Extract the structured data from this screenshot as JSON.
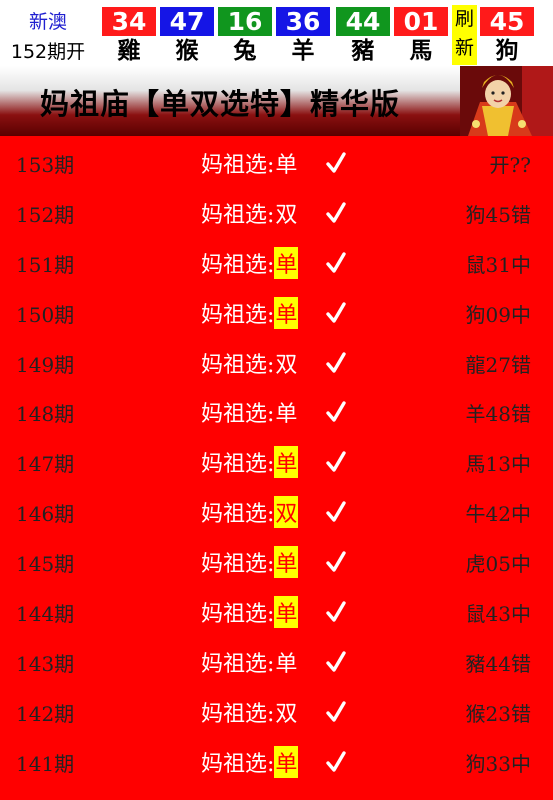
{
  "header": {
    "region": "新澳",
    "period": "152期开",
    "balls": [
      {
        "number": "34",
        "zodiac": "雞",
        "color": "#ff1a1a"
      },
      {
        "number": "47",
        "zodiac": "猴",
        "color": "#1515e6"
      },
      {
        "number": "16",
        "zodiac": "兔",
        "color": "#10961e"
      },
      {
        "number": "36",
        "zodiac": "羊",
        "color": "#1515e6"
      },
      {
        "number": "44",
        "zodiac": "豬",
        "color": "#10961e"
      },
      {
        "number": "01",
        "zodiac": "馬",
        "color": "#ff1a1a"
      },
      {
        "number": "45",
        "zodiac": "狗",
        "color": "#ff1a1a"
      }
    ],
    "refresh_top": "刷",
    "refresh_bottom": "新"
  },
  "banner": {
    "title": "妈祖庙【单双选特】精华版"
  },
  "rows": [
    {
      "period": "153期",
      "label": "妈祖选:",
      "pick": "单",
      "highlight": false,
      "result": "开??"
    },
    {
      "period": "152期",
      "label": "妈祖选:",
      "pick": "双",
      "highlight": false,
      "result": "狗45错"
    },
    {
      "period": "151期",
      "label": "妈祖选:",
      "pick": "单",
      "highlight": true,
      "result": "鼠31中"
    },
    {
      "period": "150期",
      "label": "妈祖选:",
      "pick": "单",
      "highlight": true,
      "result": "狗09中"
    },
    {
      "period": "149期",
      "label": "妈祖选:",
      "pick": "双",
      "highlight": false,
      "result": "龍27错"
    },
    {
      "period": "148期",
      "label": "妈祖选:",
      "pick": "单",
      "highlight": false,
      "result": "羊48错"
    },
    {
      "period": "147期",
      "label": "妈祖选:",
      "pick": "单",
      "highlight": true,
      "result": "馬13中"
    },
    {
      "period": "146期",
      "label": "妈祖选:",
      "pick": "双",
      "highlight": true,
      "result": "牛42中"
    },
    {
      "period": "145期",
      "label": "妈祖选:",
      "pick": "单",
      "highlight": true,
      "result": "虎05中"
    },
    {
      "period": "144期",
      "label": "妈祖选:",
      "pick": "单",
      "highlight": true,
      "result": "鼠43中"
    },
    {
      "period": "143期",
      "label": "妈祖选:",
      "pick": "单",
      "highlight": false,
      "result": "豬44错"
    },
    {
      "period": "142期",
      "label": "妈祖选:",
      "pick": "双",
      "highlight": false,
      "result": "猴23错"
    },
    {
      "period": "141期",
      "label": "妈祖选:",
      "pick": "单",
      "highlight": true,
      "result": "狗33中"
    }
  ]
}
